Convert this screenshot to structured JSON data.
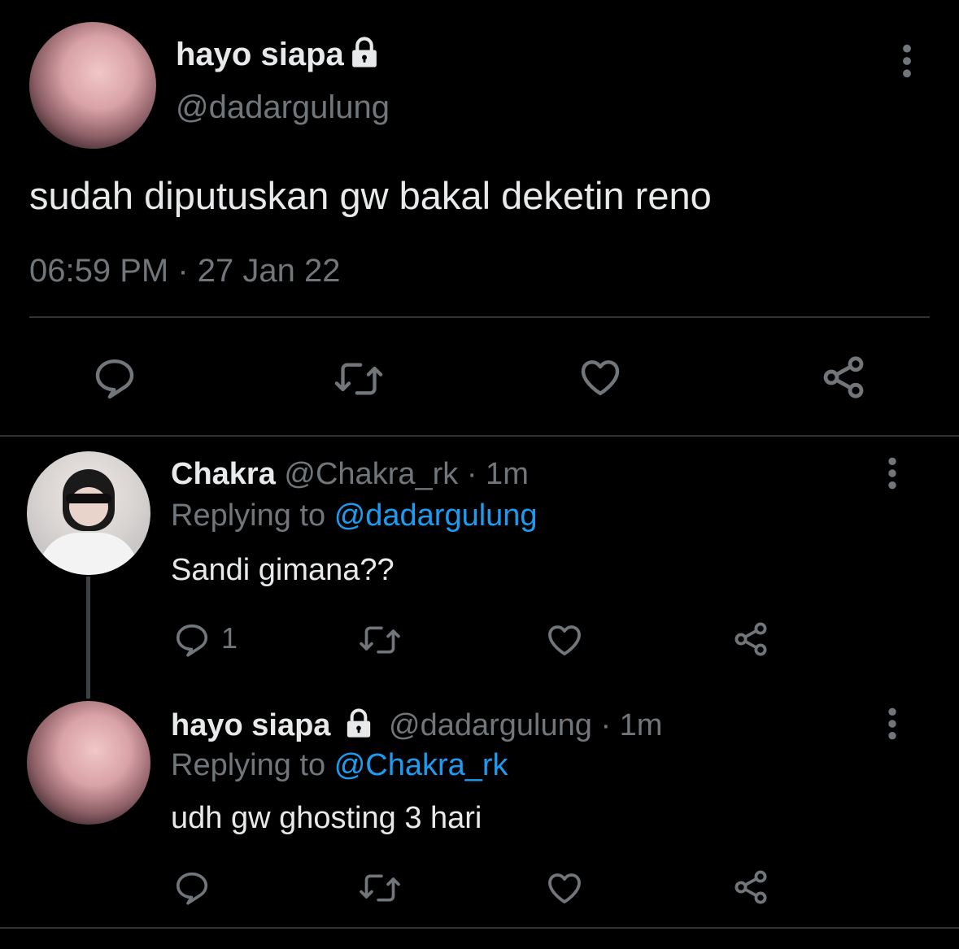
{
  "main_tweet": {
    "display_name": "hayo siapa",
    "handle": "@dadargulung",
    "text": "sudah diputuskan gw bakal deketin reno",
    "timestamp": "06:59 PM · 27 Jan 22"
  },
  "replies": [
    {
      "display_name": "Chakra",
      "handle": "@Chakra_rk",
      "time": "· 1m",
      "replying_prefix": "Replying to",
      "replying_to": "@dadargulung",
      "text": "Sandi gimana??",
      "reply_count": "1"
    },
    {
      "display_name": "hayo siapa",
      "handle": "@dadargulung",
      "time": "· 1m",
      "replying_prefix": "Replying to",
      "replying_to": "@Chakra_rk",
      "text": "udh gw ghosting 3 hari"
    }
  ],
  "colors": {
    "background": "#000000",
    "text": "#e7e9ea",
    "muted": "#71767b",
    "link": "#1d9bf0",
    "divider": "#2f3336"
  },
  "icons": [
    "lock-icon",
    "more-options-icon",
    "reply-icon",
    "retweet-icon",
    "like-icon",
    "share-icon"
  ]
}
